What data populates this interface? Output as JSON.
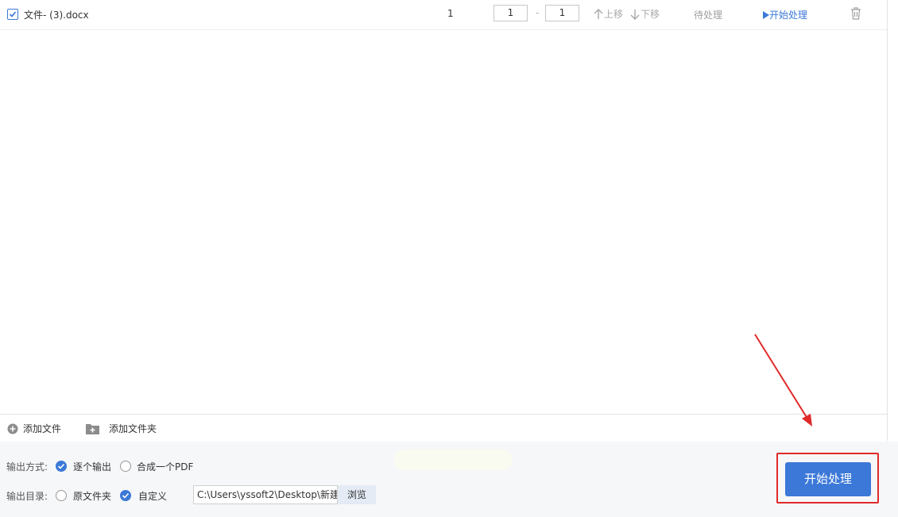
{
  "file_list": {
    "rows": [
      {
        "name": "文件- (3).docx",
        "pages": "1",
        "range_start": "1",
        "range_end": "1",
        "range_separator": "-",
        "move_up": "上移",
        "move_down": "下移",
        "status": "待处理",
        "start_link": "开始处理"
      }
    ]
  },
  "add_bar": {
    "add_file": "添加文件",
    "add_folder": "添加文件夹"
  },
  "output": {
    "mode_label": "输出方式:",
    "mode_options": [
      "逐个输出",
      "合成一个PDF"
    ],
    "dir_label": "输出目录:",
    "dir_options": [
      "原文件夹",
      "自定义"
    ],
    "path": "C:\\Users\\yssoft2\\Desktop\\新建",
    "browse": "浏览",
    "start_button": "开始处理"
  },
  "colors": {
    "accent": "#3b78d8",
    "annotation": "#e02a2a"
  }
}
